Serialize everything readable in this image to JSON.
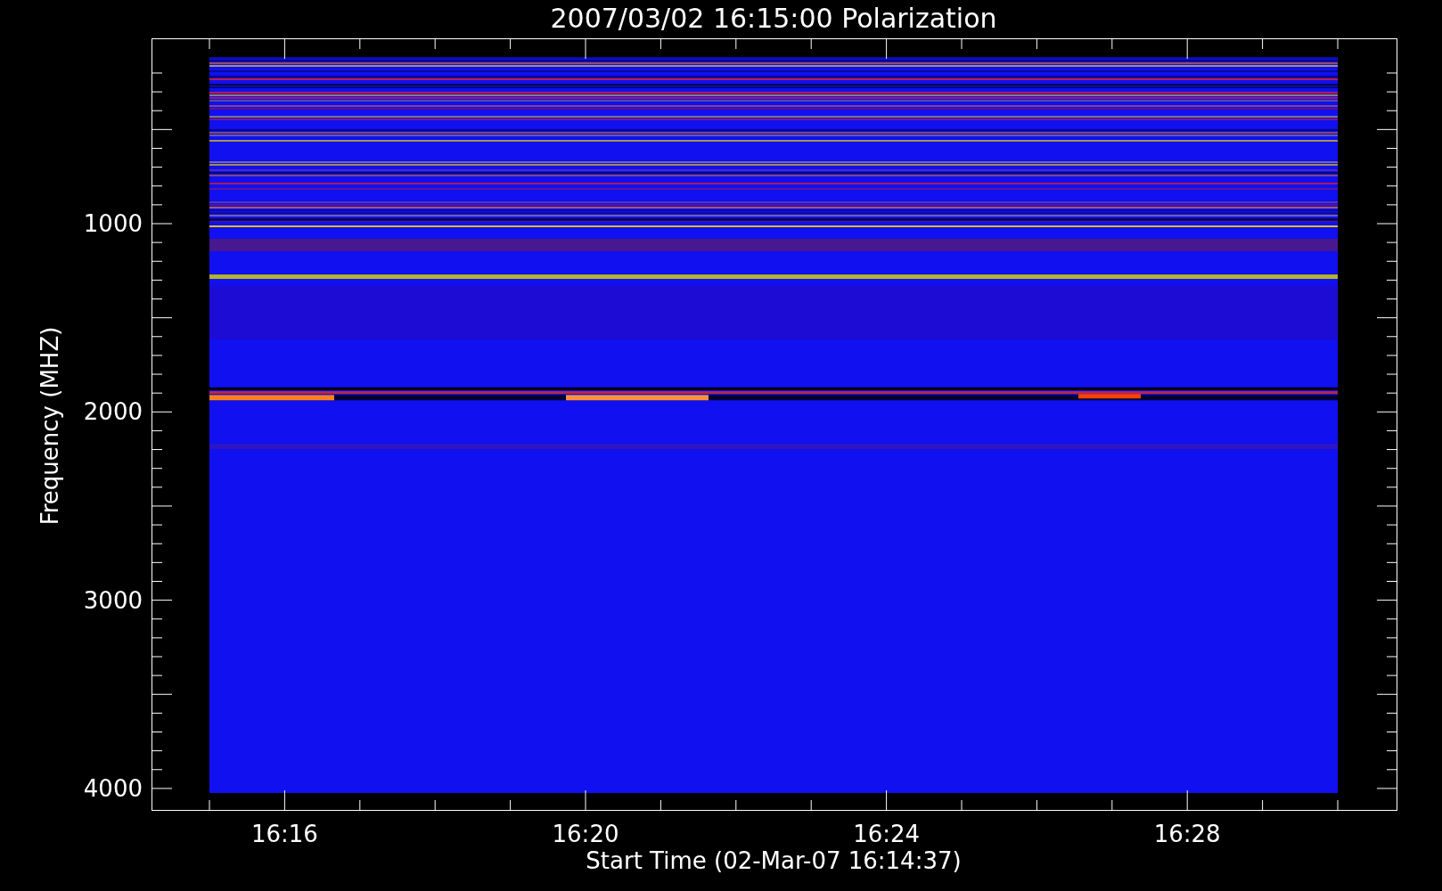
{
  "title": "2007/03/02 16:15:00 Polarization",
  "y_axis": {
    "label": "Frequency (MHZ)",
    "ticks": [
      "1000",
      "2000",
      "3000",
      "4000"
    ]
  },
  "x_axis": {
    "label": "Start Time (02-Mar-07 16:14:37)",
    "ticks": [
      "16:16",
      "16:20",
      "16:24",
      "16:28"
    ]
  }
}
